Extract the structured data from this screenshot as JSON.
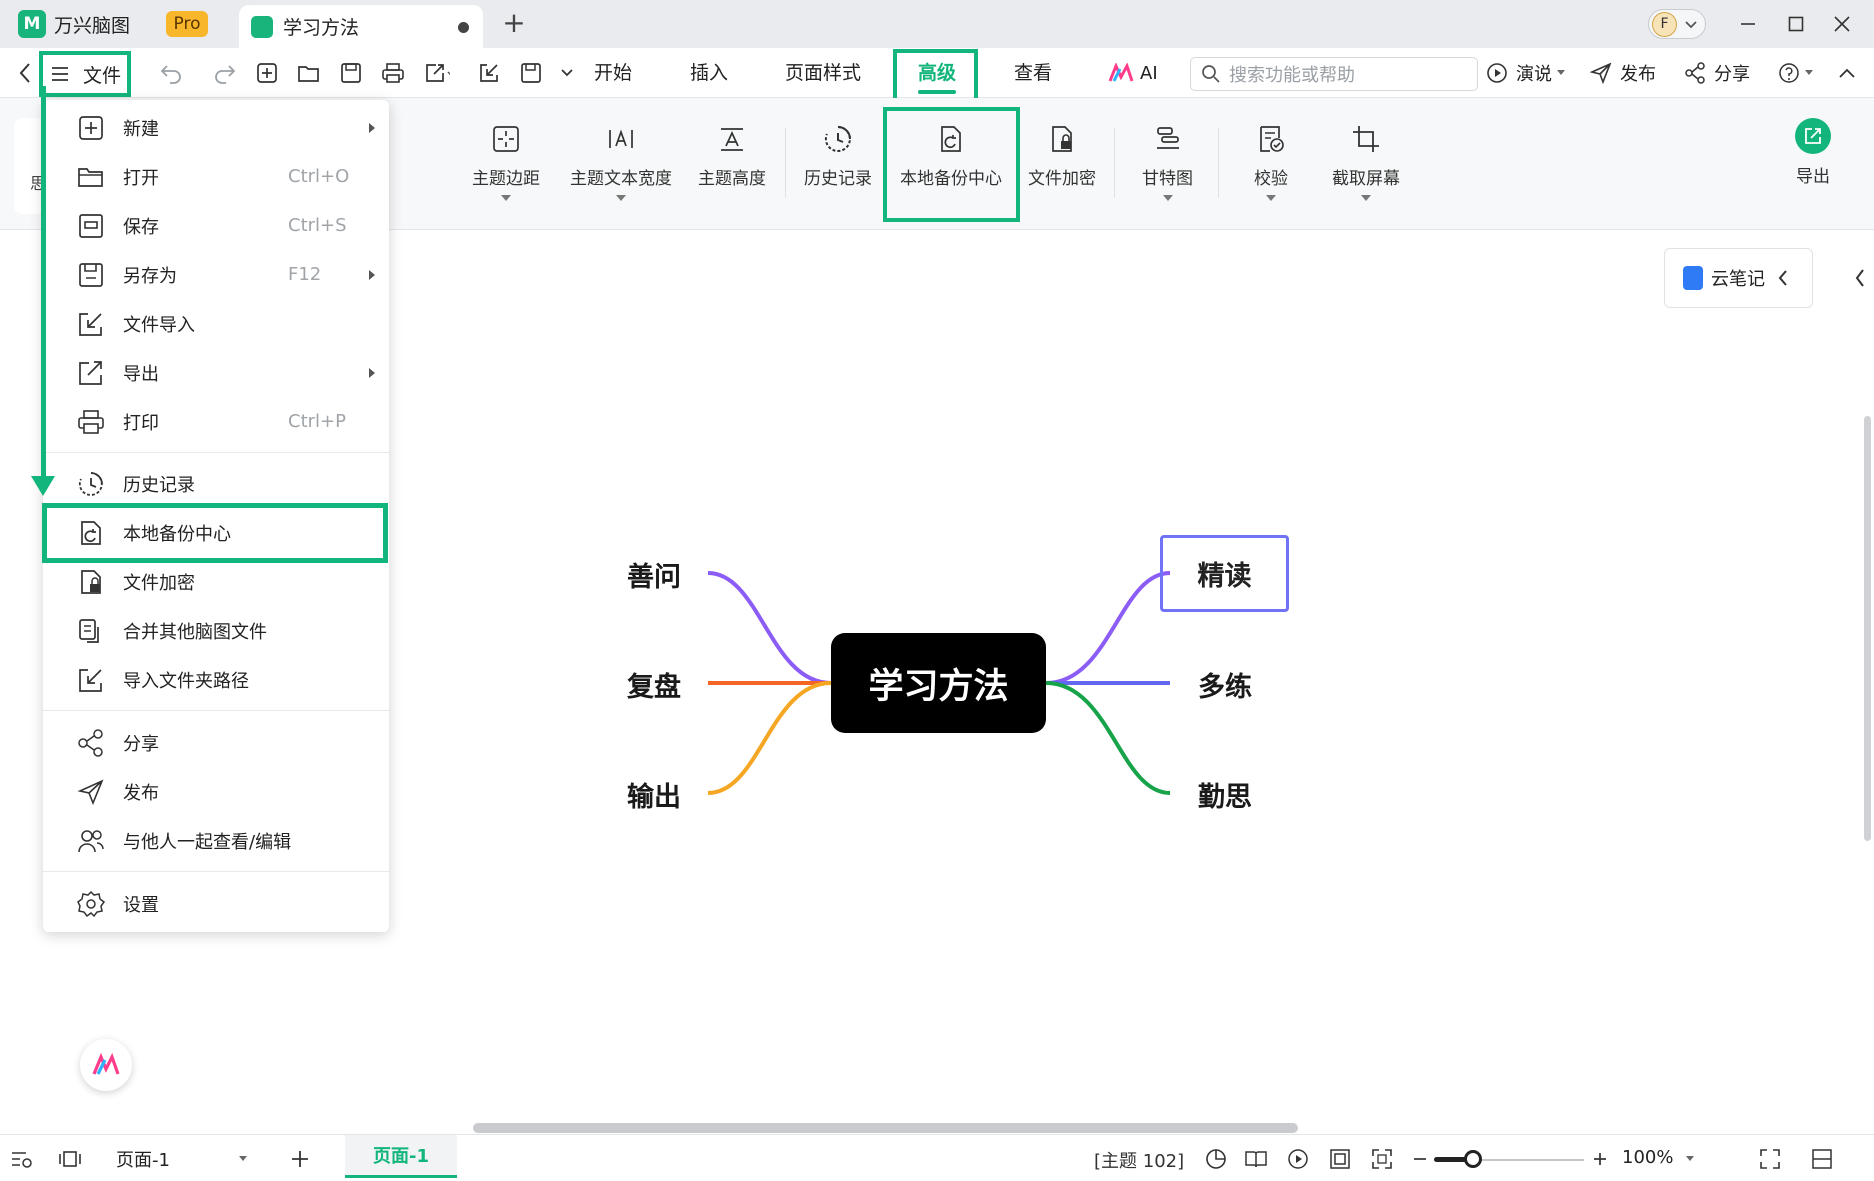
{
  "titlebar": {
    "app_name": "万兴脑图",
    "pro_badge": "Pro",
    "doc_tab_title": "学习方法",
    "avatar_initial": "F"
  },
  "menubar": {
    "file_label": "文件",
    "tabs": [
      "开始",
      "插入",
      "页面样式",
      "高级",
      "查看"
    ],
    "active_tab": "高级",
    "ai_label": "AI",
    "search_placeholder": "搜索功能或帮助",
    "present_label": "演说",
    "publish_label": "发布",
    "share_label": "分享"
  },
  "ribbon": {
    "left_card_label": "思",
    "items": [
      {
        "label": "主题边距",
        "icon": "topic-margin-icon",
        "has_dropdown": true
      },
      {
        "label": "主题文本宽度",
        "icon": "text-width-icon",
        "has_dropdown": true
      },
      {
        "label": "主题高度",
        "icon": "topic-height-icon",
        "has_dropdown": false
      },
      {
        "label": "历史记录",
        "icon": "history-icon",
        "has_dropdown": false
      },
      {
        "label": "本地备份中心",
        "icon": "local-backup-icon",
        "has_dropdown": false
      },
      {
        "label": "文件加密",
        "icon": "file-lock-icon",
        "has_dropdown": false
      },
      {
        "label": "甘特图",
        "icon": "gantt-icon",
        "has_dropdown": true
      },
      {
        "label": "校验",
        "icon": "verify-icon",
        "has_dropdown": true
      },
      {
        "label": "截取屏幕",
        "icon": "crop-icon",
        "has_dropdown": true
      }
    ],
    "export_label": "导出"
  },
  "file_menu": {
    "items": [
      {
        "label": "新建",
        "icon": "plus-square-icon",
        "shortcut": "",
        "submenu": true
      },
      {
        "label": "打开",
        "icon": "folder-icon",
        "shortcut": "Ctrl+O",
        "submenu": false
      },
      {
        "label": "保存",
        "icon": "save-icon",
        "shortcut": "Ctrl+S",
        "submenu": false
      },
      {
        "label": "另存为",
        "icon": "save-as-icon",
        "shortcut": "F12",
        "submenu": true
      },
      {
        "label": "文件导入",
        "icon": "import-icon",
        "shortcut": "",
        "submenu": false
      },
      {
        "label": "导出",
        "icon": "export-icon",
        "shortcut": "",
        "submenu": true
      },
      {
        "label": "打印",
        "icon": "print-icon",
        "shortcut": "Ctrl+P",
        "submenu": false
      },
      {
        "label": "历史记录",
        "icon": "history-icon",
        "shortcut": "",
        "submenu": false
      },
      {
        "label": "本地备份中心",
        "icon": "local-backup-icon",
        "shortcut": "",
        "submenu": false
      },
      {
        "label": "文件加密",
        "icon": "file-lock-icon",
        "shortcut": "",
        "submenu": false
      },
      {
        "label": "合并其他脑图文件",
        "icon": "merge-icon",
        "shortcut": "",
        "submenu": false
      },
      {
        "label": "导入文件夹路径",
        "icon": "import-folder-icon",
        "shortcut": "",
        "submenu": false
      },
      {
        "label": "分享",
        "icon": "share-icon",
        "shortcut": "",
        "submenu": false
      },
      {
        "label": "发布",
        "icon": "send-icon",
        "shortcut": "",
        "submenu": false
      },
      {
        "label": "与他人一起查看/编辑",
        "icon": "collaborate-icon",
        "shortcut": "",
        "submenu": false
      },
      {
        "label": "设置",
        "icon": "gear-icon",
        "shortcut": "",
        "submenu": false
      }
    ],
    "highlighted": "本地备份中心"
  },
  "canvas": {
    "cloud_note_label": "云笔记"
  },
  "mindmap": {
    "central": "学习方法",
    "left": [
      {
        "label": "善问",
        "color": "#8b5cf6"
      },
      {
        "label": "复盘",
        "color": "#f26522"
      },
      {
        "label": "输出",
        "color": "#f5a623"
      }
    ],
    "right": [
      {
        "label": "精读",
        "color": "#8b5cf6"
      },
      {
        "label": "多练",
        "color": "#6366f1"
      },
      {
        "label": "勤思",
        "color": "#16a34a"
      }
    ],
    "selected": "精读"
  },
  "statusbar": {
    "page_select": "页面-1",
    "page_tab": "页面-1",
    "topic_count": "[主题 102]",
    "zoom": "100%"
  },
  "colors": {
    "accent": "#12b57b",
    "selection": "#7073f5"
  }
}
